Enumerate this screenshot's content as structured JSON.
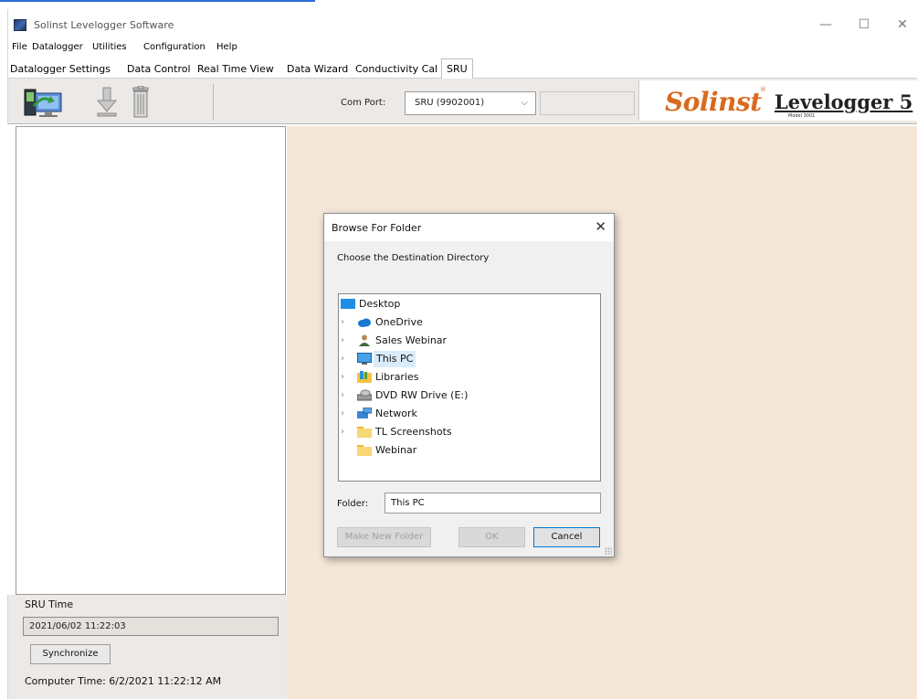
{
  "window": {
    "title": "Solinst Levelogger Software",
    "controls": [
      "—",
      "☐",
      "✕"
    ]
  },
  "menu": [
    "File",
    "Datalogger",
    "Utilities",
    "Configuration",
    "Help"
  ],
  "tabs": [
    {
      "label": "Datalogger Settings"
    },
    {
      "label": "Data Control"
    },
    {
      "label": "Real Time View"
    },
    {
      "label": "Data Wizard"
    },
    {
      "label": "Conductivity Cal"
    },
    {
      "label": "SRU",
      "active": true
    }
  ],
  "toolbar": {
    "icons": [
      "computer-transfer-icon",
      "download-icon",
      "delete-icon"
    ],
    "com_port_label": "Com Port:",
    "com_port_value": "SRU (9902001)"
  },
  "logo": {
    "brand": "Solinst",
    "product": "Levelogger 5",
    "model": "Model 3001"
  },
  "sru_panel": {
    "sru_time_label": "SRU Time",
    "sru_time_value": "2021/06/02 11:22:03",
    "synchronize_label": "Synchronize",
    "computer_time": "Computer Time: 6/2/2021 11:22:12 AM"
  },
  "dialog": {
    "title": "Browse For Folder",
    "description": "Choose the Destination Directory",
    "tree": [
      {
        "label": "Desktop",
        "icon": "desktop-icon",
        "level": 0,
        "expandable": false
      },
      {
        "label": "OneDrive",
        "icon": "onedrive-cloud-icon",
        "level": 1,
        "expandable": true
      },
      {
        "label": "Sales Webinar",
        "icon": "user-icon",
        "level": 1,
        "expandable": true
      },
      {
        "label": "This PC",
        "icon": "this-pc-icon",
        "level": 1,
        "expandable": true,
        "selected": true
      },
      {
        "label": "Libraries",
        "icon": "libraries-icon",
        "level": 1,
        "expandable": true
      },
      {
        "label": "DVD RW Drive (E:)",
        "icon": "dvd-drive-icon",
        "level": 1,
        "expandable": true
      },
      {
        "label": "Network",
        "icon": "network-icon",
        "level": 1,
        "expandable": true
      },
      {
        "label": "TL Screenshots",
        "icon": "folder-icon",
        "level": 1,
        "expandable": true
      },
      {
        "label": "Webinar",
        "icon": "folder-icon",
        "level": 1,
        "expandable": false
      }
    ],
    "folder_label": "Folder:",
    "folder_value": "This PC",
    "buttons": {
      "make_new_folder": "Make New Folder",
      "ok": "OK",
      "cancel": "Cancel"
    }
  },
  "colors": {
    "workspace": "#f4e7d8",
    "toolbar": "#ece9e6",
    "brand_orange": "#d96a1e",
    "selection": "#d9ebf9"
  }
}
